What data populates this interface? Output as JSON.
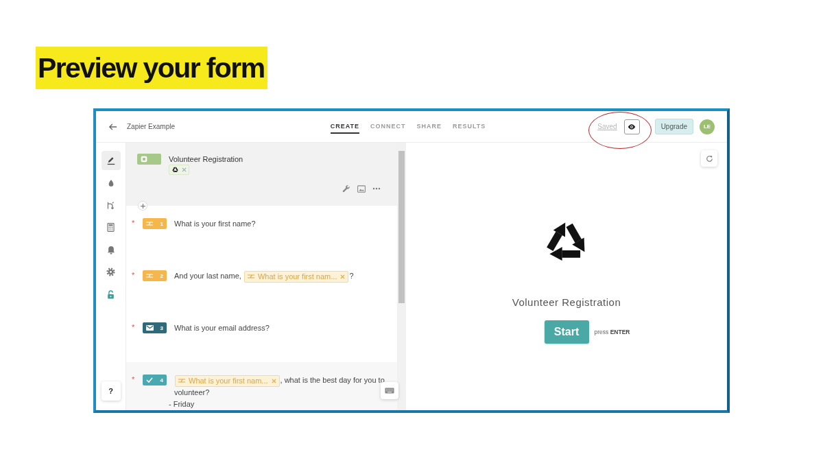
{
  "slide_title": "Preview your form",
  "header": {
    "form_name": "Zapier Example",
    "tabs": [
      {
        "label": "CREATE",
        "selected": true
      },
      {
        "label": "CONNECT",
        "selected": false
      },
      {
        "label": "SHARE",
        "selected": false
      },
      {
        "label": "RESULTS",
        "selected": false
      }
    ],
    "saved_link": "Saved",
    "upgrade_button": "Upgrade",
    "avatar_initials": "LE"
  },
  "sidebar": {
    "items": [
      {
        "kind": "edit",
        "selected": true
      },
      {
        "kind": "theme",
        "selected": false
      },
      {
        "kind": "logic",
        "selected": false
      },
      {
        "kind": "calculator",
        "selected": false
      },
      {
        "kind": "notifications",
        "selected": false
      },
      {
        "kind": "settings",
        "selected": false
      },
      {
        "kind": "access",
        "selected": false
      }
    ],
    "help_button": "?"
  },
  "editor": {
    "welcome": {
      "title": "Volunteer Registration",
      "highlighted": true
    },
    "questions": [
      {
        "number": "1",
        "kind": "short_text",
        "required_mark": "*",
        "highlighted": false,
        "parts": [
          {
            "kind": "text",
            "text": "What is your first name?"
          }
        ]
      },
      {
        "number": "2",
        "kind": "short_text",
        "required_mark": "*",
        "highlighted": false,
        "parts": [
          {
            "kind": "text",
            "text": "And your last name,"
          },
          {
            "kind": "recall",
            "text": "What is your first nam..."
          },
          {
            "kind": "text",
            "text": "?"
          }
        ]
      },
      {
        "number": "3",
        "kind": "email",
        "required_mark": "*",
        "highlighted": false,
        "parts": [
          {
            "kind": "text",
            "text": "What is your email address?"
          }
        ]
      },
      {
        "number": "4",
        "kind": "multiple_choice",
        "required_mark": "*",
        "highlighted": true,
        "parts": [
          {
            "kind": "recall",
            "text": "What is your first nam..."
          },
          {
            "kind": "text",
            "text": ", what is the best day for you to"
          },
          {
            "kind": "line",
            "text": "volunteer?"
          }
        ],
        "options": [
          "- Friday"
        ]
      }
    ]
  },
  "preview": {
    "title": "Volunteer Registration",
    "start_button": "Start",
    "hint": "press **ENTER**"
  }
}
